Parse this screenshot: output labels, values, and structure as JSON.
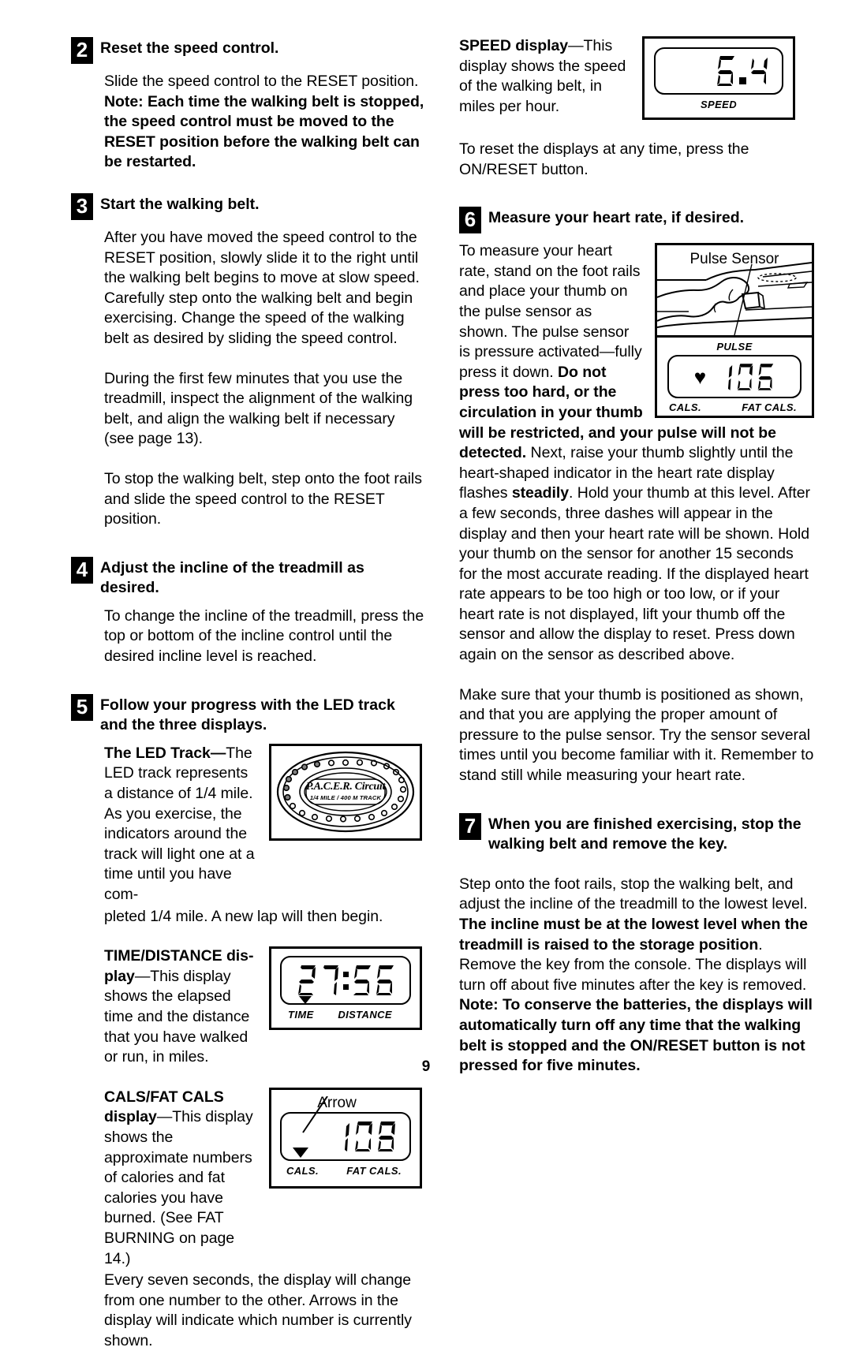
{
  "page": {
    "number": "9"
  },
  "left_column": {
    "step2": {
      "num": "2",
      "title": "Reset the speed control.",
      "para_plain": "Slide the speed control to the RESET position. ",
      "para_bold": "Note: Each time the walking belt is stopped, the speed control must be moved to the RESET position before the walking belt can be restarted."
    },
    "step3": {
      "num": "3",
      "title": "Start the walking belt.",
      "para1": "After you have moved the speed control to the RESET position, slowly slide it to the right until the walking belt begins to move at slow speed. Carefully step onto the walking belt and begin exercising. Change the speed of the walking belt as desired by sliding the speed control.",
      "para2": "During the first few minutes that you use the treadmill, inspect the alignment of the walking belt, and align the walking belt if necessary (see page 13).",
      "para3": "To stop the walking belt, step onto the foot rails and slide the speed control to the RESET position."
    },
    "step4": {
      "num": "4",
      "title": "Adjust the incline of the treadmill as desired.",
      "para1": "To change the incline of the treadmill, press the top or bottom of the incline control until the desired incline level is reached."
    },
    "step5": {
      "num": "5",
      "title": "Follow your progress with the LED track and the three displays."
    },
    "led_track": {
      "heading_bold": "The LED Track",
      "heading_dash": "—",
      "heading_rest": "The LED track represents a distance of 1/4 mile. As you exercise, the indicators around the track will light one at a time until you have com-",
      "continued": "pleted 1/4 mile. A new lap will then begin.",
      "figure": {
        "brand": "P.A.C.E.R. Circuit",
        "subtitle": "1/4 MILE / 400 M TRACK"
      }
    },
    "time_distance": {
      "heading_bold_1": "TIME/DISTANCE dis-",
      "heading_bold_2": "play",
      "heading_dash": "—",
      "heading_rest": "This display shows the elapsed time and the distance that you have walked or run, in miles.",
      "display": {
        "value": "27:56",
        "left_label": "TIME",
        "right_label": "DISTANCE"
      }
    },
    "cals_fat_cals": {
      "heading_bold_1": "CALS/FAT CALS",
      "heading_bold_2": "display",
      "heading_dash": "—",
      "heading_rest": "This display shows the approximate numbers of calories and fat calories you have burned. (See FAT BURNING on page 14.)",
      "para_after": "Every seven seconds, the display will change from one number to the other. Arrows in the display will indicate which number is currently shown.",
      "display": {
        "callout": "Arrow",
        "value": "108",
        "left_label": "CALS.",
        "right_label": "FAT CALS."
      }
    }
  },
  "right_column": {
    "speed": {
      "heading_bold": "SPEED display",
      "heading_dash": "—",
      "heading_rest": "This display shows the speed of the walking belt, in miles per hour.",
      "para_after": "To reset the displays at any time, press the ON/RESET button.",
      "display": {
        "value": "6.4",
        "label": "SPEED"
      }
    },
    "step6": {
      "num": "6",
      "title": "Measure your heart rate, if desired.",
      "para_plain_1": "To measure your heart rate, stand on the foot rails and place your thumb on the pulse sensor as shown. The pulse sensor is pressure activated—fully press it down. ",
      "para_bold_1": "Do not press too hard, or the circulation in your thumb will be restricted, and your pulse will not be detected.",
      "para_plain_2": " Next, raise your thumb slightly until the heart-shaped indicator in the heart rate display flashes ",
      "para_bold_2": "steadily",
      "para_plain_3": ". Hold your thumb at this level. After a few seconds, three dashes will appear in the display and then your heart rate will be shown. Hold your thumb on the sensor for another 15 seconds for the most accurate reading. If the displayed heart rate appears to be too high or too low, or if your heart rate is not displayed, lift your thumb off the sensor and allow the display to reset. Press down again on the sensor as described above.",
      "para_after": "Make sure that your thumb is positioned as shown, and that you are applying the proper amount of pressure to the pulse sensor. Try the sensor several times until you become familiar with it. Remember to stand still while measuring your heart rate.",
      "figure": {
        "callout": "Pulse Sensor",
        "pulse_label": "PULSE",
        "value": "106",
        "left_label": "CALS.",
        "right_label": "FAT CALS.",
        "heart_icon": "heart-icon"
      }
    },
    "step7": {
      "num": "7",
      "title": "When you are finished exercising, stop the walking belt and remove the key.",
      "para_plain_1": "Step onto the foot rails, stop the walking belt, and adjust the incline of the treadmill to the lowest level. ",
      "para_bold_1": "The incline must be at the lowest level when the treadmill is raised to the storage position",
      "para_plain_2": ". Remove the key from the console. The displays will turn off about five minutes after the key is removed. ",
      "para_bold_2": "Note: To conserve the batteries, the displays will automatically turn off any time that the walking belt is stopped and the ON/RESET button is not pressed for five minutes."
    }
  }
}
